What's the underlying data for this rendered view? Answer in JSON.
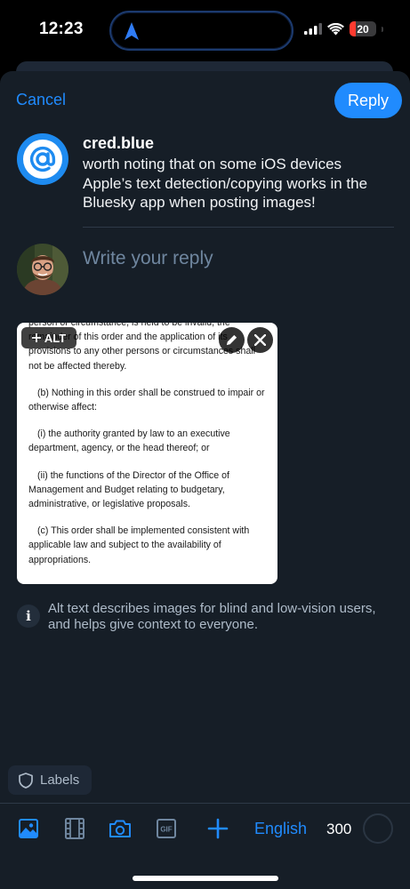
{
  "status_bar": {
    "time": "12:23",
    "battery": "20"
  },
  "header": {
    "cancel_label": "Cancel",
    "reply_label": "Reply"
  },
  "quoted_post": {
    "author": "cred.blue",
    "text": "worth noting that on some iOS devices Apple’s text detection/copying works in the Bluesky app when posting images!"
  },
  "composer": {
    "placeholder": "Write your reply"
  },
  "attachment": {
    "alt_label": "ALT",
    "document_paragraphs": [
      "person or circumstance, is held to be invalid, the remainder of this order and the application of its provisions to any other persons or circumstances shall not be affected thereby.",
      "(b) Nothing in this order shall be construed to impair or otherwise affect:",
      "(i) the authority granted by law to an executive department, agency, or the head thereof; or",
      "(ii) the functions of the Director of the Office of Management and Budget relating to budgetary, administrative, or legislative proposals.",
      "(c) This order shall be implemented consistent with applicable law and subject to the availability of appropriations."
    ]
  },
  "alt_info": {
    "text": "Alt text describes images for blind and low-vision users, and helps give context to everyone."
  },
  "labels": {
    "label": "Labels"
  },
  "toolbar": {
    "icons": [
      "image-icon",
      "video-icon",
      "camera-icon",
      "gif-icon",
      "plus-icon"
    ],
    "gif_label": "GIF",
    "language": "English",
    "char_remaining": "300"
  },
  "colors": {
    "accent": "#208bfe",
    "sheet_bg": "#161e27",
    "muted_text": "#aebbc9"
  }
}
